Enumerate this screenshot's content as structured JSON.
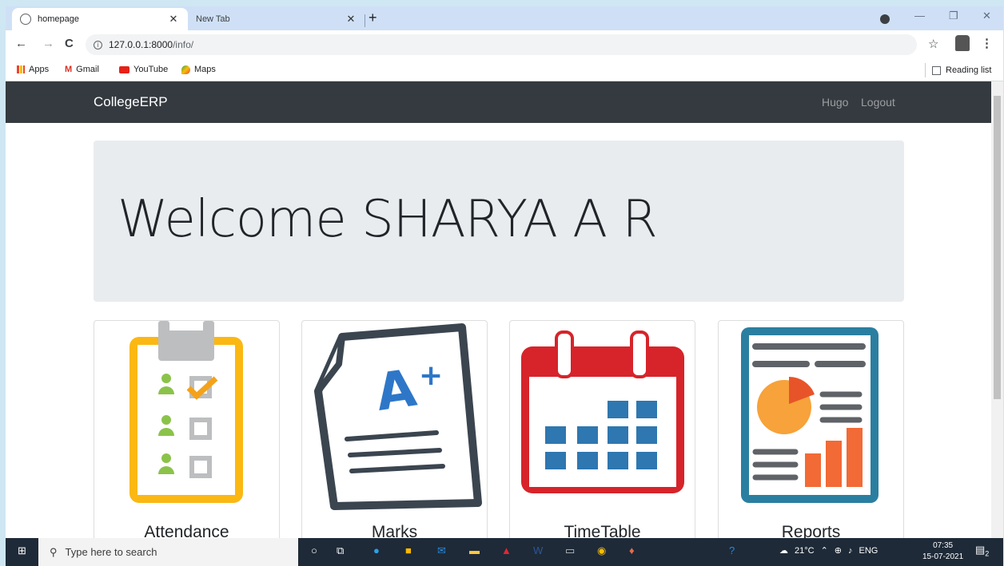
{
  "browser": {
    "tabs": [
      {
        "title": "homepage"
      },
      {
        "title": "New Tab"
      }
    ],
    "url_host": "127.0.0.1:8000",
    "url_path": "/info/",
    "bookmarks": [
      "Apps",
      "Gmail",
      "YouTube",
      "Maps"
    ],
    "reading_list": "Reading list"
  },
  "app": {
    "brand": "CollegeERP",
    "nav": [
      "Hugo",
      "Logout"
    ],
    "welcome": "Welcome SHARYA A R",
    "cards": [
      {
        "title": "Attendance"
      },
      {
        "title": "Marks"
      },
      {
        "title": "TimeTable"
      },
      {
        "title": "Reports"
      }
    ]
  },
  "taskbar": {
    "search_placeholder": "Type here to search",
    "weather": "21°C",
    "lang": "ENG",
    "time": "07:35",
    "date": "15-07-2021",
    "notifications": "2"
  },
  "colors": {
    "navbar": "#343a40",
    "jumbotron": "#e9ecef",
    "attendance": "#fbb813",
    "timetable": "#d6242a",
    "grid": "#2e77b0",
    "reports": "#2a7fa0"
  }
}
